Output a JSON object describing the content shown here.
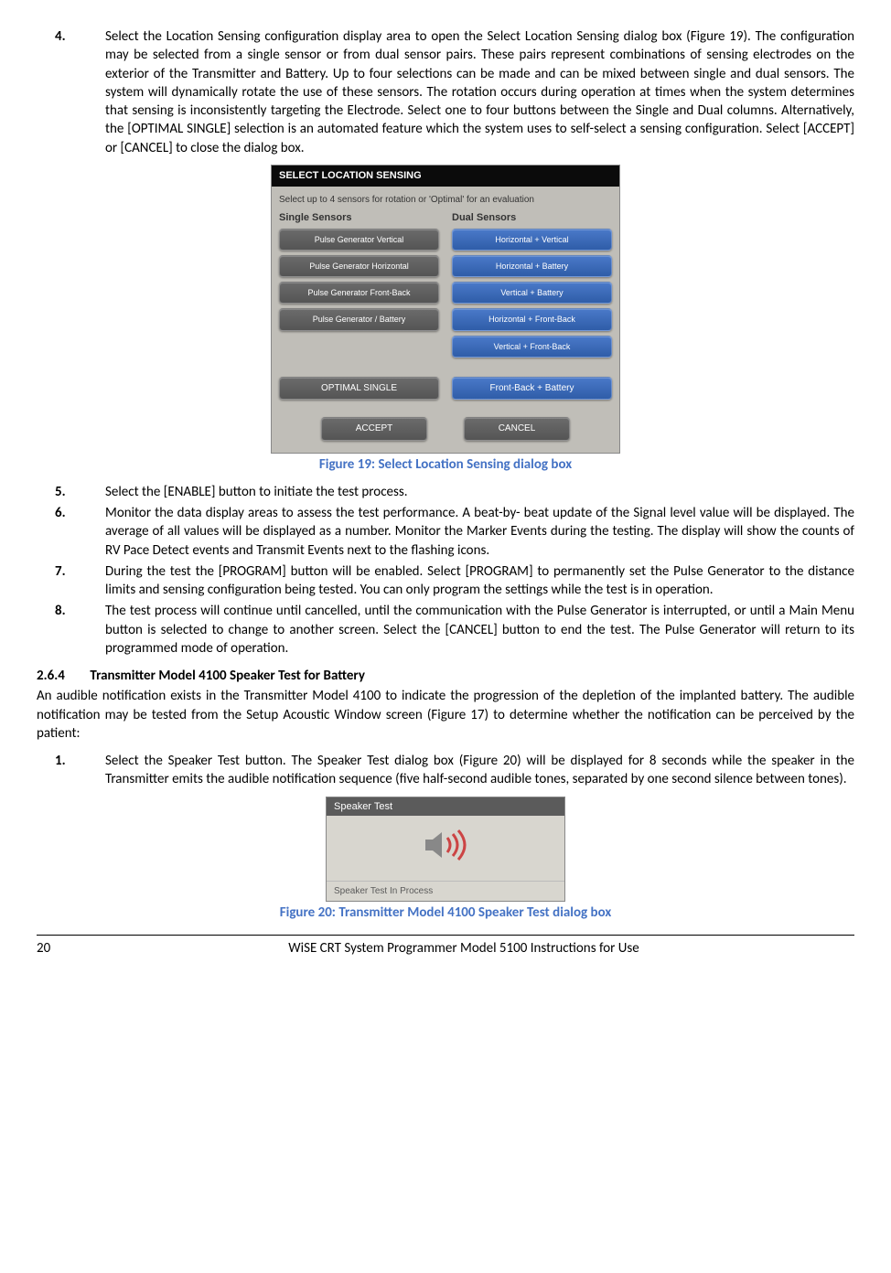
{
  "items4to8": {
    "n4": "4.",
    "t4": "Select the Location Sensing configuration display area to open the Select Location Sensing dialog box (Figure 19). The configuration may be selected from a single sensor or from dual sensor pairs.  These pairs represent combinations of sensing electrodes on the exterior of the Transmitter and Battery. Up to four selections can be made and can be mixed between single and dual sensors.  The system will dynamically rotate the use of these sensors.  The rotation occurs during operation at times when the system determines that sensing is inconsistently targeting the Electrode.  Select one to four buttons between the Single and Dual columns. Alternatively, the [OPTIMAL SINGLE] selection is an automated feature which the system uses to self-select a sensing configuration.  Select [ACCEPT] or [CANCEL] to close the dialog box.",
    "n5": "5.",
    "t5": "Select the [ENABLE] button to initiate the test process.",
    "n6": "6.",
    "t6": "Monitor the data display areas to assess the test performance. A beat-by- beat update of the Signal level value will be displayed. The average of all values will be displayed as a number.  Monitor the Marker Events during the testing.  The display will show the counts of RV Pace Detect events and Transmit Events next to the flashing icons.",
    "n7": "7.",
    "t7": "During the test the [PROGRAM] button will be enabled.  Select [PROGRAM] to permanently set the Pulse Generator to the distance limits and sensing configuration being tested. You can only program the settings while the test is in operation.",
    "n8": "8.",
    "t8": "The test process will continue until cancelled, until the communication with the Pulse Generator is interrupted, or until a Main Menu button is selected to change to another screen. Select the [CANCEL] button to end the test.  The Pulse Generator will return to its programmed mode of operation."
  },
  "dialog1": {
    "title": "SELECT LOCATION SENSING",
    "sub": "Select up to 4 sensors for rotation or 'Optimal' for an evaluation",
    "singleHead": "Single Sensors",
    "dualHead": "Dual Sensors",
    "single": [
      "Pulse Generator Vertical",
      "Pulse Generator Horizontal",
      "Pulse Generator Front-Back",
      "Pulse Generator / Battery"
    ],
    "dual": [
      "Horizontal + Vertical",
      "Horizontal + Battery",
      "Vertical + Battery",
      "Horizontal + Front-Back",
      "Vertical + Front-Back"
    ],
    "optimal": "OPTIMAL SINGLE",
    "lastDual": "Front-Back + Battery",
    "accept": "ACCEPT",
    "cancel": "CANCEL"
  },
  "figure19": "Figure 19: Select Location Sensing dialog box",
  "section": {
    "num": "2.6.4",
    "title": "Transmitter Model 4100 Speaker Test for Battery",
    "intro": "An audible notification exists in the Transmitter Model 4100 to indicate the progression of the depletion of the implanted battery.  The audible notification may be tested from the Setup Acoustic Window screen (Figure 17) to determine whether the notification can be perceived by the patient:"
  },
  "step1": {
    "n": "1.",
    "t": "Select the Speaker Test button.  The Speaker Test dialog box (Figure 20) will be displayed for 8 seconds while the speaker in the Transmitter emits the audible notification sequence (five half-second audible tones, separated by one second silence between tones)."
  },
  "dialog2": {
    "title": "Speaker Test",
    "status": "Speaker Test In Process"
  },
  "figure20": "Figure 20: Transmitter Model 4100 Speaker Test dialog box",
  "footer": {
    "page": "20",
    "title": "WiSE CRT System Programmer Model 5100 Instructions for Use"
  }
}
